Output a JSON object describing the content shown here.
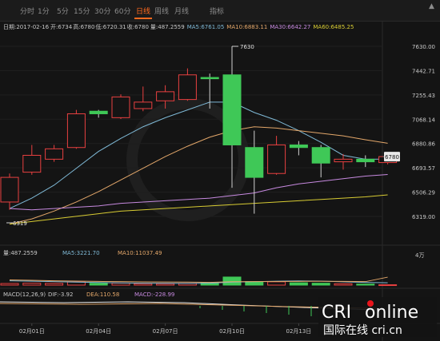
{
  "tabs": [
    {
      "label": "分时"
    },
    {
      "label": "1分"
    },
    {
      "label": "5分"
    },
    {
      "label": "15分"
    },
    {
      "label": "30分"
    },
    {
      "label": "60分"
    },
    {
      "label": "日线",
      "active": true
    },
    {
      "label": "周线"
    },
    {
      "label": "月线"
    },
    {
      "label": "指标"
    }
  ],
  "colors": {
    "up": "#e84040",
    "down": "#3fc857",
    "ma5": "#7fb9d6",
    "ma10": "#e3a76a",
    "ma30": "#c78ae0",
    "ma60": "#d8cc33",
    "macd_dif": "#e8e8e8",
    "macd_dea": "#e3a76a"
  },
  "watermark": {
    "main": "CRI",
    "suffix": "online",
    "sub": "国际在线 cri.cn"
  },
  "chart_data": [
    {
      "type": "candlestick",
      "info": {
        "date": "日期:2017-02-16",
        "open": "开:6734",
        "high": "高:6780",
        "low": "低:6720.31",
        "close": "收:6780",
        "volume": "量:487.2559",
        "ma5": "MA5:6761.05",
        "ma10": "MA10:6883.11",
        "ma30": "MA30:6642.27",
        "ma60": "MA60:6485.25"
      },
      "y_ticks": [
        "7630.00",
        "7442.71",
        "7255.43",
        "7068.14",
        "6880.86",
        "6693.57",
        "6506.29",
        "6319.00"
      ],
      "ylim": [
        6319,
        7630
      ],
      "x_ticks": [
        "02月01日",
        "02月04日",
        "02月07日",
        "02月10日",
        "02月13日"
      ],
      "current_price": "6780",
      "high_label": "7630",
      "low_label": "6319",
      "candles": [
        {
          "o": 6430,
          "c": 6620,
          "h": 6650,
          "l": 6370
        },
        {
          "o": 6660,
          "c": 6790,
          "h": 6870,
          "l": 6640
        },
        {
          "o": 6760,
          "c": 6840,
          "h": 6870,
          "l": 6740
        },
        {
          "o": 6850,
          "c": 7110,
          "h": 7140,
          "l": 6840
        },
        {
          "o": 7130,
          "c": 7110,
          "h": 7140,
          "l": 7080
        },
        {
          "o": 7080,
          "c": 7240,
          "h": 7260,
          "l": 7070
        },
        {
          "o": 7150,
          "c": 7200,
          "h": 7320,
          "l": 7130
        },
        {
          "o": 7210,
          "c": 7280,
          "h": 7330,
          "l": 7150
        },
        {
          "o": 7220,
          "c": 7410,
          "h": 7460,
          "l": 7210
        },
        {
          "o": 7390,
          "c": 7380,
          "h": 7420,
          "l": 7150
        },
        {
          "o": 7410,
          "c": 6870,
          "h": 7630,
          "l": 6540
        },
        {
          "o": 6850,
          "c": 6620,
          "h": 6980,
          "l": 6340
        },
        {
          "o": 6650,
          "c": 6870,
          "h": 6940,
          "l": 6640
        },
        {
          "o": 6870,
          "c": 6850,
          "h": 6900,
          "l": 6790
        },
        {
          "o": 6850,
          "c": 6730,
          "h": 6870,
          "l": 6620
        },
        {
          "o": 6740,
          "c": 6760,
          "h": 6800,
          "l": 6680
        },
        {
          "o": 6760,
          "c": 6740,
          "h": 6790,
          "l": 6700
        },
        {
          "o": 6734,
          "c": 6780,
          "h": 6780,
          "l": 6720.31
        }
      ],
      "series": [
        {
          "name": "MA5",
          "values": [
            6380,
            6460,
            6560,
            6690,
            6820,
            6920,
            7010,
            7080,
            7140,
            7200,
            7200,
            7120,
            7060,
            6980,
            6890,
            6790,
            6760,
            6761
          ]
        },
        {
          "name": "MA10",
          "values": [
            6260,
            6300,
            6360,
            6430,
            6510,
            6600,
            6690,
            6780,
            6860,
            6930,
            6980,
            7010,
            7000,
            6980,
            6960,
            6940,
            6910,
            6883
          ]
        },
        {
          "name": "MA30",
          "values": [
            6380,
            6370,
            6380,
            6390,
            6400,
            6420,
            6430,
            6440,
            6450,
            6460,
            6480,
            6500,
            6540,
            6570,
            6590,
            6610,
            6630,
            6642
          ]
        },
        {
          "name": "MA60",
          "values": [
            6260,
            6280,
            6300,
            6320,
            6340,
            6360,
            6370,
            6380,
            6390,
            6400,
            6410,
            6420,
            6430,
            6440,
            6450,
            6460,
            6470,
            6485
          ]
        }
      ]
    },
    {
      "type": "bar",
      "info": {
        "volume": "量:487.2559",
        "ma5": "MA5:3221.70",
        "ma10": "MA10:11037.49"
      },
      "y_tick": "4万",
      "ylim": [
        0,
        40000
      ],
      "values": [
        2200,
        2600,
        2400,
        4300,
        2500,
        2800,
        2000,
        1900,
        2400,
        3600,
        11200,
        4800,
        4600,
        3200,
        2600,
        1900,
        1400,
        487
      ],
      "series": [
        {
          "name": "MA5",
          "values": [
            6000,
            5400,
            4800,
            4200,
            3600,
            3000,
            2700,
            2500,
            2400,
            2600,
            4200,
            4700,
            5400,
            5800,
            5600,
            4600,
            3700,
            3221
          ]
        },
        {
          "name": "MA10",
          "values": [
            7200,
            6600,
            6000,
            5500,
            5100,
            4800,
            4500,
            4300,
            4100,
            3800,
            4700,
            4900,
            5000,
            5200,
            5300,
            5200,
            4800,
            11037
          ]
        }
      ]
    },
    {
      "type": "macd",
      "info": {
        "title": "MACD(12,26,9)",
        "dif": "DIF:-3.92",
        "dea": "DEA:110.58",
        "macd": "MACD:-228.99"
      }
    }
  ]
}
